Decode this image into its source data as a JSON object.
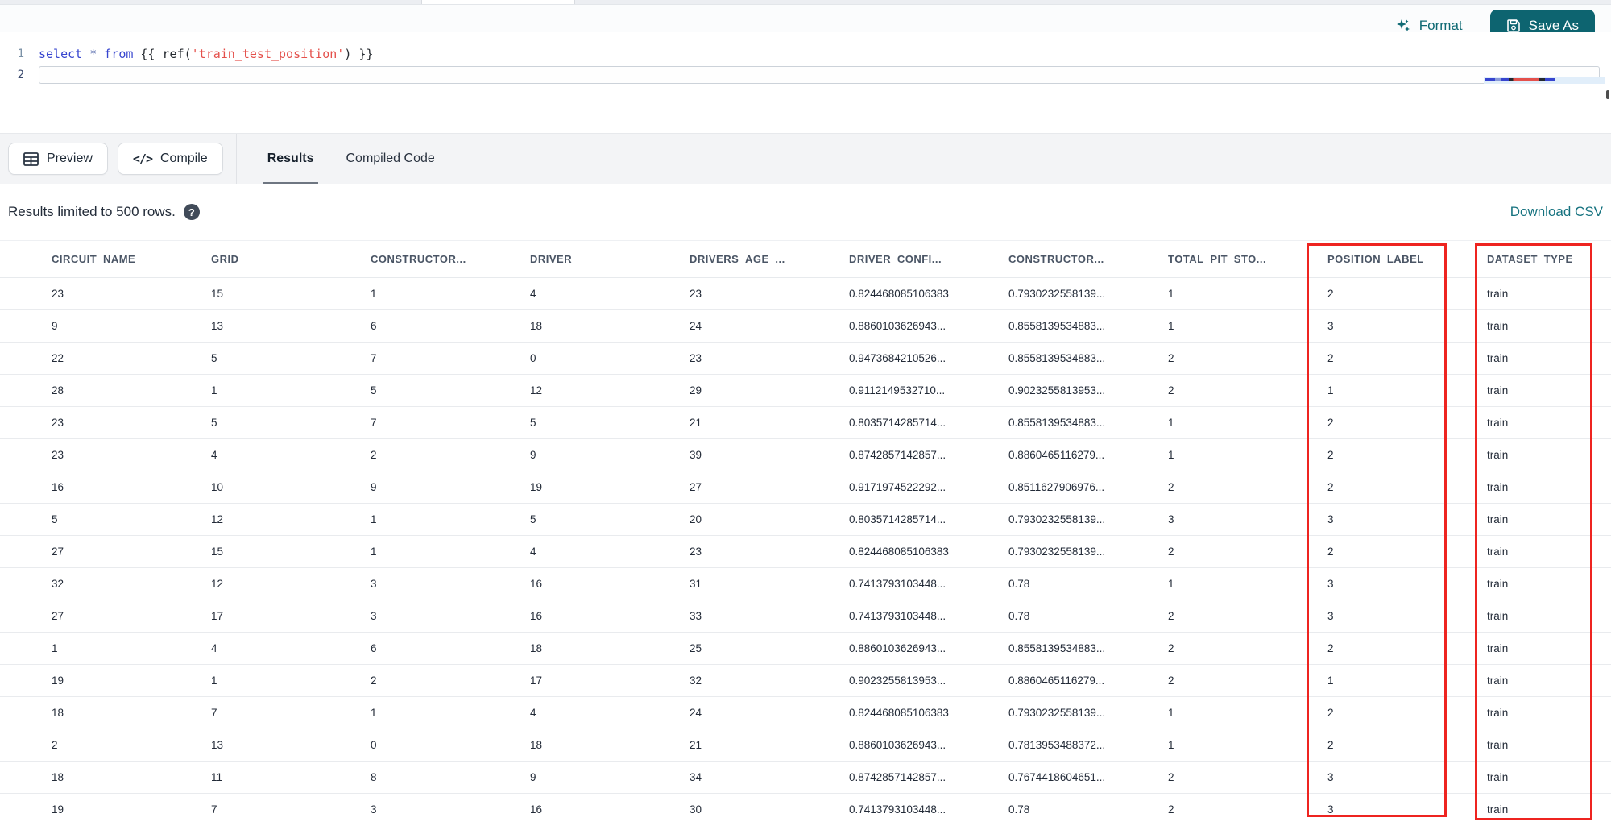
{
  "topbar": {
    "format_label": "Format",
    "save_as_label": "Save As"
  },
  "editor": {
    "lines": [
      {
        "number": "1",
        "active": false,
        "tokens": [
          {
            "text": "select",
            "type": "keyword"
          },
          {
            "text": " ",
            "type": "plain"
          },
          {
            "text": "*",
            "type": "operator"
          },
          {
            "text": " ",
            "type": "plain"
          },
          {
            "text": "from",
            "type": "keyword"
          },
          {
            "text": " {{ ",
            "type": "plain"
          },
          {
            "text": "ref(",
            "type": "plain"
          },
          {
            "text": "'train_test_position'",
            "type": "string"
          },
          {
            "text": ")",
            "type": "plain"
          },
          {
            "text": " }}",
            "type": "plain"
          }
        ]
      },
      {
        "number": "2",
        "active": true,
        "tokens": []
      }
    ]
  },
  "actions": {
    "preview_label": "Preview",
    "compile_label": "Compile",
    "compile_icon_glyph": "</>"
  },
  "tabs": [
    {
      "label": "Results",
      "active": true
    },
    {
      "label": "Compiled Code",
      "active": false
    }
  ],
  "results_bar": {
    "notice": "Results limited to 500 rows.",
    "help_icon_glyph": "?",
    "download_label": "Download CSV"
  },
  "table": {
    "columns": [
      "CIRCUIT_NAME",
      "GRID",
      "CONSTRUCTOR...",
      "DRIVER",
      "DRIVERS_AGE_...",
      "DRIVER_CONFI...",
      "CONSTRUCTOR...",
      "TOTAL_PIT_STO...",
      "POSITION_LABEL",
      "DATASET_TYPE"
    ],
    "rows": [
      [
        "23",
        "15",
        "1",
        "4",
        "23",
        "0.824468085106383",
        "0.7930232558139...",
        "1",
        "2",
        "train"
      ],
      [
        "9",
        "13",
        "6",
        "18",
        "24",
        "0.8860103626943...",
        "0.8558139534883...",
        "1",
        "3",
        "train"
      ],
      [
        "22",
        "5",
        "7",
        "0",
        "23",
        "0.9473684210526...",
        "0.8558139534883...",
        "2",
        "2",
        "train"
      ],
      [
        "28",
        "1",
        "5",
        "12",
        "29",
        "0.9112149532710...",
        "0.9023255813953...",
        "2",
        "1",
        "train"
      ],
      [
        "23",
        "5",
        "7",
        "5",
        "21",
        "0.8035714285714...",
        "0.8558139534883...",
        "1",
        "2",
        "train"
      ],
      [
        "23",
        "4",
        "2",
        "9",
        "39",
        "0.8742857142857...",
        "0.8860465116279...",
        "1",
        "2",
        "train"
      ],
      [
        "16",
        "10",
        "9",
        "19",
        "27",
        "0.9171974522292...",
        "0.8511627906976...",
        "2",
        "2",
        "train"
      ],
      [
        "5",
        "12",
        "1",
        "5",
        "20",
        "0.8035714285714...",
        "0.7930232558139...",
        "3",
        "3",
        "train"
      ],
      [
        "27",
        "15",
        "1",
        "4",
        "23",
        "0.824468085106383",
        "0.7930232558139...",
        "2",
        "2",
        "train"
      ],
      [
        "32",
        "12",
        "3",
        "16",
        "31",
        "0.7413793103448...",
        "0.78",
        "1",
        "3",
        "train"
      ],
      [
        "27",
        "17",
        "3",
        "16",
        "33",
        "0.7413793103448...",
        "0.78",
        "2",
        "3",
        "train"
      ],
      [
        "1",
        "4",
        "6",
        "18",
        "25",
        "0.8860103626943...",
        "0.8558139534883...",
        "2",
        "2",
        "train"
      ],
      [
        "19",
        "1",
        "2",
        "17",
        "32",
        "0.9023255813953...",
        "0.8860465116279...",
        "2",
        "1",
        "train"
      ],
      [
        "18",
        "7",
        "1",
        "4",
        "24",
        "0.824468085106383",
        "0.7930232558139...",
        "1",
        "2",
        "train"
      ],
      [
        "2",
        "13",
        "0",
        "18",
        "21",
        "0.8860103626943...",
        "0.7813953488372...",
        "1",
        "2",
        "train"
      ],
      [
        "18",
        "11",
        "8",
        "9",
        "34",
        "0.8742857142857...",
        "0.7674418604651...",
        "2",
        "3",
        "train"
      ],
      [
        "19",
        "7",
        "3",
        "16",
        "30",
        "0.7413793103448...",
        "0.78",
        "2",
        "3",
        "train"
      ]
    ]
  },
  "annotations": {
    "highlight_color": "#ee2420",
    "highlighted_columns": [
      "POSITION_LABEL",
      "DATASET_TYPE"
    ]
  },
  "colors": {
    "accent_teal": "#0d6470",
    "link_teal": "#15727f",
    "keyword_blue": "#3745cf",
    "string_red": "#e4504b"
  }
}
